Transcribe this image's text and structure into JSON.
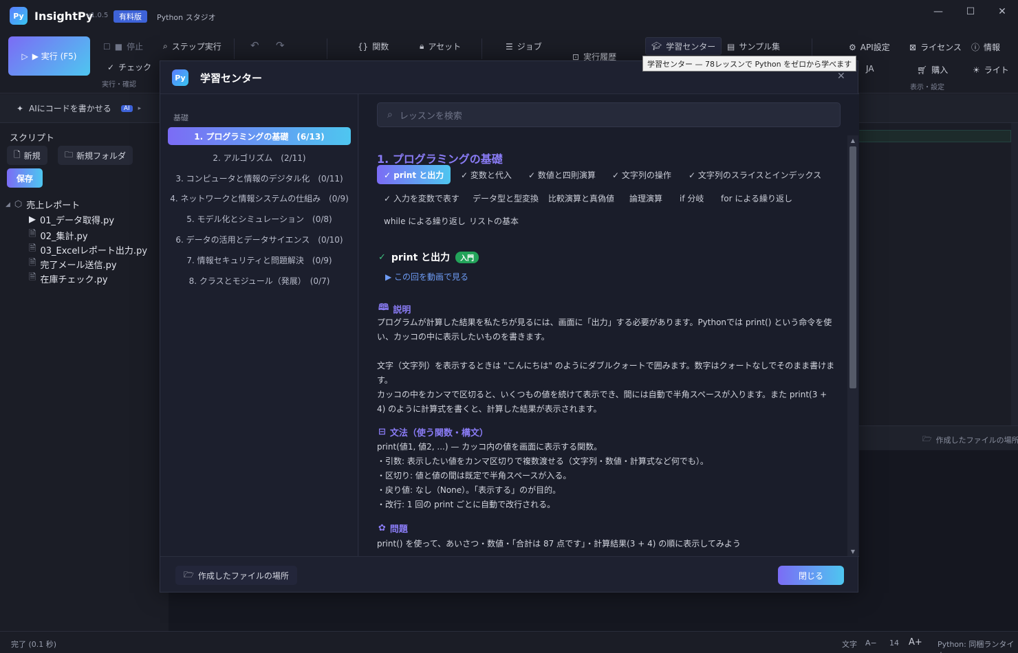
{
  "titlebar": {
    "logo": "Py",
    "app_name": "InsightPy",
    "version": "v1.0.5",
    "badge": "有料版",
    "subtitle": "Python スタジオ",
    "minimize": "—",
    "maximize": "☐",
    "close": "✕"
  },
  "toolbar": {
    "run": "▶ 実行 (F5)",
    "stop": "停止",
    "step": "ステップ実行",
    "check": "チェック",
    "group_run": "実行・確認",
    "functions": "関数",
    "assets": "アセット",
    "jobs": "ジョブ",
    "history": "実行履歴",
    "learning": "学習センター",
    "samples": "サンプル集",
    "api": "API設定",
    "license": "ライセンス",
    "info": "情報",
    "lang": "JA",
    "purchase": "購入",
    "theme": "ライト",
    "group_view": "表示・設定"
  },
  "tooltip": "学習センター — 78レッスンで Python をゼロから学べます",
  "sidebar": {
    "ai_label": "AIにコードを書かせる",
    "ai_badge": "AI",
    "scripts_label": "スクリプト",
    "new": "新規",
    "new_folder": "新規フォルダ",
    "save": "保存",
    "folder": "売上レポート",
    "files": [
      "01_データ取得.py",
      "02_集計.py",
      "03_Excelレポート出力.py",
      "完了メール送信.py",
      "在庫チェック.py"
    ]
  },
  "editor": {
    "created_files": "作成したファイルの場所"
  },
  "modal": {
    "logo": "Py",
    "title": "学習センター",
    "section": "基礎",
    "categories": [
      "1. プログラミングの基礎　(6/13)",
      "2. アルゴリズム　(2/11)",
      "3. コンピュータと情報のデジタル化　(0/11)",
      "4. ネットワークと情報システムの仕組み　(0/9)",
      "5. モデル化とシミュレーション　(0/8)",
      "6. データの活用とデータサイエンス　(0/10)",
      "7. 情報セキュリティと問題解決　(0/9)",
      "8. クラスとモジュール（発展）　(0/7)"
    ],
    "search_placeholder": "レッスンを検索",
    "heading": "1. プログラミングの基礎",
    "lessons": [
      "✓ print と出力",
      "✓ 変数と代入",
      "✓ 数値と四則演算",
      "✓ 文字列の操作",
      "✓ 文字列のスライスとインデックス",
      "✓ 入力を変数で表す",
      "データ型と型変換",
      "比較演算と真偽値",
      "論理演算",
      "if 分岐",
      "for による繰り返し",
      "while による繰り返し",
      "リストの基本"
    ],
    "lesson_title": "print と出力",
    "lesson_level": "入門",
    "video_link": "▶ この回を動画で見る",
    "explain_label": "説明",
    "explain": [
      "プログラムが計算した結果を私たちが見るには、画面に「出力」する必要があります。Pythonでは print() という命令を使い、カッコの中に表示したいものを書きます。",
      "文字（文字列）を表示するときは \"こんにちは\" のようにダブルクォートで囲みます。数字はクォートなしでそのまま書けます。",
      "カッコの中をカンマで区切ると、いくつもの値を続けて表示でき、間には自動で半角スペースが入ります。また print(3 + 4) のように計算式を書くと、計算した結果が表示されます。"
    ],
    "syntax_label": "文法（使う関数・構文）",
    "syntax": [
      "print(値1, 値2, ...) — カッコ内の値を画面に表示する関数。",
      "・引数: 表示したい値をカンマ区切りで複数渡せる（文字列・数値・計算式など何でも）。",
      "・区切り: 値と値の間は既定で半角スペースが入る。",
      "・戻り値: なし（None）。「表示する」のが目的。",
      "・改行: 1 回の print ごとに自動で改行される。"
    ],
    "problem_label": "問題",
    "problem_text": "print() を使って、あいさつ・数値・「合計は 87 点です」・計算結果(3 + 4) の順に表示してみよう",
    "open_files": "作成したファイルの場所",
    "close": "閉じる"
  },
  "statusbar": {
    "status": "完了 (0.1 秒)",
    "font_label": "文字",
    "font_minus": "A−",
    "font_size": "14",
    "font_plus": "A+",
    "runtime": "Python: 同梱ランタイム"
  }
}
